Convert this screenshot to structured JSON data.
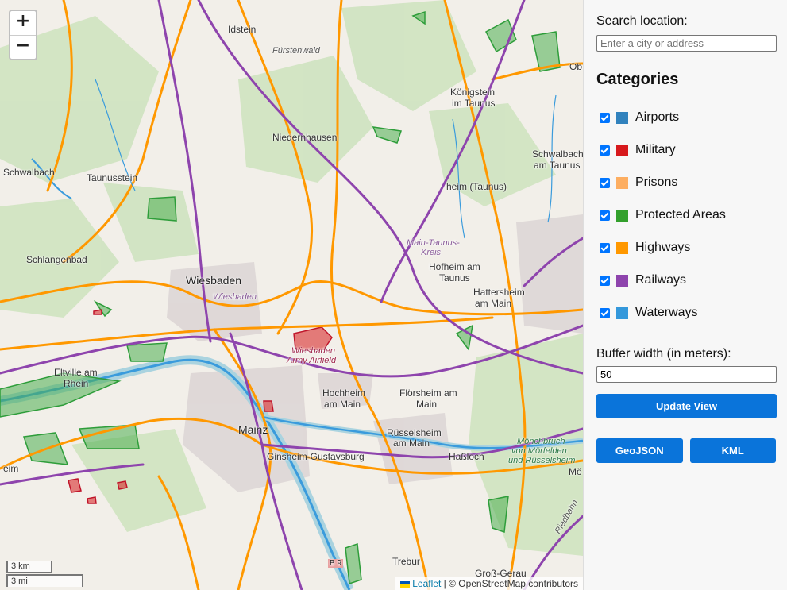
{
  "map": {
    "zoom_in": "+",
    "zoom_out": "−",
    "scale_metric": "3 km",
    "scale_imperial": "3 mi",
    "attribution_link": "Leaflet",
    "attribution_text": "| © OpenStreetMap contributors",
    "places": {
      "idstein": "Idstein",
      "fuerstenwald": "Fürstenwald",
      "koenigstein": "Königstein",
      "im_taunus": "im Taunus",
      "obe": "Ob",
      "niedernhausen": "Niedernhausen",
      "schwalbach_left": "Schwalbach",
      "taunusstein": "Taunusstein",
      "schwalbach_right": "Schwalbach",
      "am_taunus": "am Taunus",
      "heim_taunus": "heim (Taunus)",
      "schlangenbad": "Schlangenbad",
      "main_taunus": "Main-Taunus-",
      "kreis": "Kreis",
      "hofheim": "Hofheim am",
      "taunus": "Taunus",
      "wiesbaden": "Wiesbaden",
      "wiesbaden_small": "Wiesbaden",
      "hattersheim": "Hattersheim",
      "am_main_1": "am Main",
      "army_airfield_1": "Wiesbaden",
      "army_airfield_2": "Army Airfield",
      "eltville": "Eltville am",
      "rhein": "Rhein",
      "hochheim": "Hochheim",
      "am_main_2": "am Main",
      "floersheim": "Flörsheim am",
      "main": "Main",
      "mainz": "Mainz",
      "ruesselsheim": "Rüsselsheim",
      "am_main_3": "am Main",
      "moenchbruch_1": "Mönchbruch",
      "moenchbruch_2": "von Mörfelden",
      "moenchbruch_3": "und Rüsselsheim",
      "ginsheim": "Ginsheim-Gustavsburg",
      "hassloch": "Haßloch",
      "moe": "Mö",
      "eim": "eim",
      "trebur": "Trebur",
      "gross_gerau": "Groß-Gerau",
      "riedbahn": "Riedbahn",
      "b9": "B 9"
    }
  },
  "panel": {
    "search_label": "Search location:",
    "search_placeholder": "Enter a city or address",
    "categories_title": "Categories",
    "categories": [
      {
        "label": "Airports",
        "color": "#3182bd",
        "checked": true
      },
      {
        "label": "Military",
        "color": "#d7191c",
        "checked": true
      },
      {
        "label": "Prisons",
        "color": "#fdae61",
        "checked": true
      },
      {
        "label": "Protected Areas",
        "color": "#33a02c",
        "checked": true
      },
      {
        "label": "Highways",
        "color": "#ff9800",
        "checked": true
      },
      {
        "label": "Railways",
        "color": "#8e44ad",
        "checked": true
      },
      {
        "label": "Waterways",
        "color": "#3498db",
        "checked": true
      }
    ],
    "buffer_label": "Buffer width (in meters):",
    "buffer_value": "50",
    "update_button": "Update View",
    "geojson_button": "GeoJSON",
    "kml_button": "KML"
  }
}
